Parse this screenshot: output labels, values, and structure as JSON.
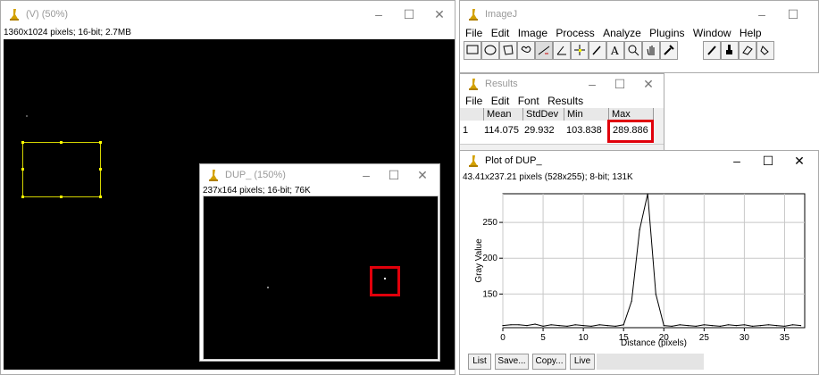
{
  "window_v": {
    "title": "(V) (50%)",
    "info": "1360x1024 pixels; 16-bit; 2.7MB"
  },
  "window_dup": {
    "title": "DUP_ (150%)",
    "info": "237x164 pixels; 16-bit; 76K"
  },
  "imagej": {
    "title": "ImageJ",
    "menu": [
      "File",
      "Edit",
      "Image",
      "Process",
      "Analyze",
      "Plugins",
      "Window",
      "Help"
    ],
    "tools": [
      "rectangle-tool-icon",
      "oval-tool-icon",
      "polygon-tool-icon",
      "freehand-tool-icon",
      "line-tool-icon",
      "angle-tool-icon",
      "point-tool-icon",
      "wand-tool-icon",
      "text-tool-icon",
      "magnifier-tool-icon",
      "hand-tool-icon",
      "dropper-tool-icon",
      "pencil-tool-icon",
      "brush-tool-icon",
      "eraser-tool-icon",
      "flood-fill-tool-icon"
    ]
  },
  "results": {
    "title": "Results",
    "menu": [
      "File",
      "Edit",
      "Font",
      "Results"
    ],
    "columns": [
      "",
      "Mean",
      "StdDev",
      "Min",
      "Max"
    ],
    "row": [
      "1",
      "114.075",
      "29.932",
      "103.838",
      "289.886"
    ]
  },
  "plot": {
    "title": "Plot of DUP_",
    "info": "43.41x237.21 pixels (528x255); 8-bit; 131K",
    "buttons": {
      "list": "List",
      "save": "Save...",
      "copy": "Copy...",
      "live": "Live"
    }
  },
  "colors": {
    "highlight": "#e0000b",
    "roi": "#d4d400"
  },
  "chart_data": {
    "type": "line",
    "xlabel": "Distance (pixels)",
    "ylabel": "Gray Value",
    "xlim": [
      0,
      37.5
    ],
    "ylim": [
      103,
      290
    ],
    "x_ticks": [
      0,
      5,
      10,
      15,
      20,
      25,
      30,
      35
    ],
    "y_ticks": [
      150,
      200,
      250
    ],
    "grid": true,
    "x": [
      0,
      1,
      2,
      3,
      4,
      5,
      6,
      7,
      8,
      9,
      10,
      11,
      12,
      13,
      14,
      15,
      16,
      17,
      18,
      19,
      20,
      21,
      22,
      23,
      24,
      25,
      26,
      27,
      28,
      29,
      30,
      31,
      32,
      33,
      34,
      35,
      36,
      37
    ],
    "y": [
      106,
      107,
      107,
      106,
      108,
      105,
      107,
      106,
      105,
      107,
      106,
      105,
      107,
      106,
      105,
      107,
      140,
      240,
      290,
      150,
      106,
      105,
      107,
      106,
      105,
      107,
      106,
      105,
      107,
      106,
      107,
      105,
      106,
      107,
      106,
      105,
      107,
      106
    ]
  }
}
